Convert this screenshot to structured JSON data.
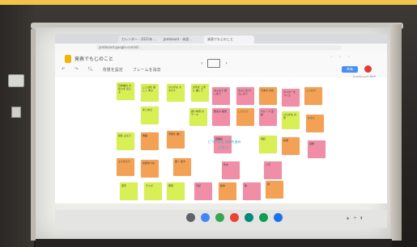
{
  "browser": {
    "tabs": [
      "カレンダー - 2021年 …",
      "Jamboard - 未設…",
      "発表でもじのこと"
    ],
    "url": "jamboard.google.com/d/…"
  },
  "app": {
    "title": "発表でもじのこと",
    "toolbar": [
      "背景を設定",
      "フレームを消去"
    ],
    "share_label": "共有",
    "settings_label": "Jamboard 設定"
  },
  "center_text": "どうかなな 発表を進め こちら！",
  "notes": [
    {
      "color": "lime",
      "text": "日本語の 大切さを 伝える"
    },
    {
      "color": "lime",
      "text": "ことばを 楽しく 学ぶ"
    },
    {
      "color": "lime",
      "text": "ひらがな カタカナ"
    },
    {
      "color": "lime",
      "text": "文字を 上手に 書こう"
    },
    {
      "color": "pink",
      "text": "みんなで 話し合う"
    },
    {
      "color": "pink",
      "text": "かんじの れんしゅう"
    },
    {
      "color": "orange",
      "text": "日本の 文化"
    },
    {
      "color": "pink",
      "text": "ポスターを つくる"
    },
    {
      "color": "orange",
      "text": "ことわざ"
    },
    {
      "color": "lime",
      "text": "まとめる"
    },
    {
      "color": "lime",
      "text": "調べ学習 のテーマ"
    },
    {
      "color": "pink",
      "text": "発表の 練習"
    },
    {
      "color": "orange",
      "text": "しりとり"
    },
    {
      "color": "pink",
      "text": "グループ 活動"
    },
    {
      "color": "lime",
      "text": "ひらがな の形"
    },
    {
      "color": "orange",
      "text": "かるた"
    },
    {
      "color": "lime",
      "text": "詩を よもう"
    },
    {
      "color": "orange",
      "text": "物語"
    },
    {
      "color": "orange",
      "text": "手紙を 書く"
    },
    {
      "color": "pink",
      "text": "図書館"
    },
    {
      "color": "lime",
      "text": "音読"
    },
    {
      "color": "orange",
      "text": "新聞"
    },
    {
      "color": "pink",
      "text": "感想"
    },
    {
      "color": "orange",
      "text": "ふりかえり"
    },
    {
      "color": "orange",
      "text": "言葉あつめ"
    },
    {
      "color": "orange",
      "text": "聞く 話す"
    },
    {
      "color": "pink",
      "text": "作文"
    },
    {
      "color": "pink",
      "text": "メモ"
    },
    {
      "color": "lime",
      "text": "漢字"
    },
    {
      "color": "lime",
      "text": "クイズ"
    },
    {
      "color": "lime",
      "text": "発見"
    },
    {
      "color": "pink",
      "text": "日記"
    },
    {
      "color": "orange",
      "text": "絵本"
    },
    {
      "color": "pink",
      "text": "歌"
    },
    {
      "color": "orange",
      "text": "劇"
    }
  ],
  "colors": {
    "lime": "#d8ef55",
    "orange": "#f3a255",
    "pink": "#ef8ea6",
    "accent": "#4a8ef2"
  },
  "tools": [
    "pen-icon",
    "eraser-icon",
    "select-icon",
    "sticky-note-icon",
    "image-icon",
    "shape-icon",
    "textbox-icon",
    "laser-icon"
  ],
  "dock_apps": [
    "launcher-icon",
    "chrome-icon",
    "files-icon",
    "play-icon",
    "meet-icon",
    "classroom-icon",
    "docs-icon"
  ]
}
